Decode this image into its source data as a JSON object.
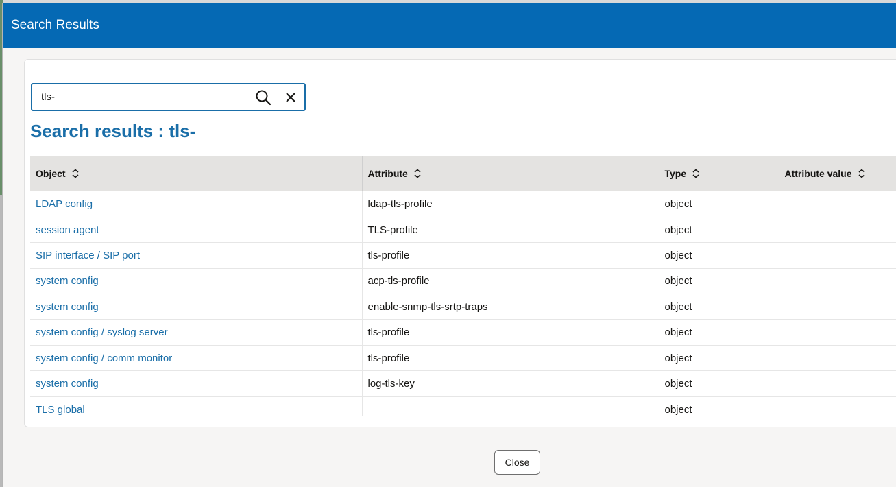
{
  "dialog": {
    "title": "Search Results"
  },
  "search": {
    "value": "tls-",
    "search_icon": "search-icon",
    "clear_icon": "close-icon"
  },
  "results": {
    "title": "Search results : tls-"
  },
  "table": {
    "columns": [
      {
        "label": "Object"
      },
      {
        "label": "Attribute"
      },
      {
        "label": "Type"
      },
      {
        "label": "Attribute value"
      }
    ],
    "rows": [
      {
        "object": "LDAP config",
        "attribute": "ldap-tls-profile",
        "type": "object",
        "value": ""
      },
      {
        "object": "session agent",
        "attribute": "TLS-profile",
        "type": "object",
        "value": ""
      },
      {
        "object": "SIP interface / SIP port",
        "attribute": "tls-profile",
        "type": "object",
        "value": ""
      },
      {
        "object": "system config",
        "attribute": "acp-tls-profile",
        "type": "object",
        "value": ""
      },
      {
        "object": "system config",
        "attribute": "enable-snmp-tls-srtp-traps",
        "type": "object",
        "value": ""
      },
      {
        "object": "system config / syslog server",
        "attribute": "tls-profile",
        "type": "object",
        "value": ""
      },
      {
        "object": "system config / comm monitor",
        "attribute": "tls-profile",
        "type": "object",
        "value": ""
      },
      {
        "object": "system config",
        "attribute": "log-tls-key",
        "type": "object",
        "value": ""
      },
      {
        "object": "TLS global",
        "attribute": "",
        "type": "object",
        "value": ""
      }
    ]
  },
  "footer": {
    "close_label": "Close"
  },
  "colors": {
    "header_bg": "#0569b4",
    "link": "#1a6ea8",
    "table_header_bg": "#e4e3e1"
  }
}
